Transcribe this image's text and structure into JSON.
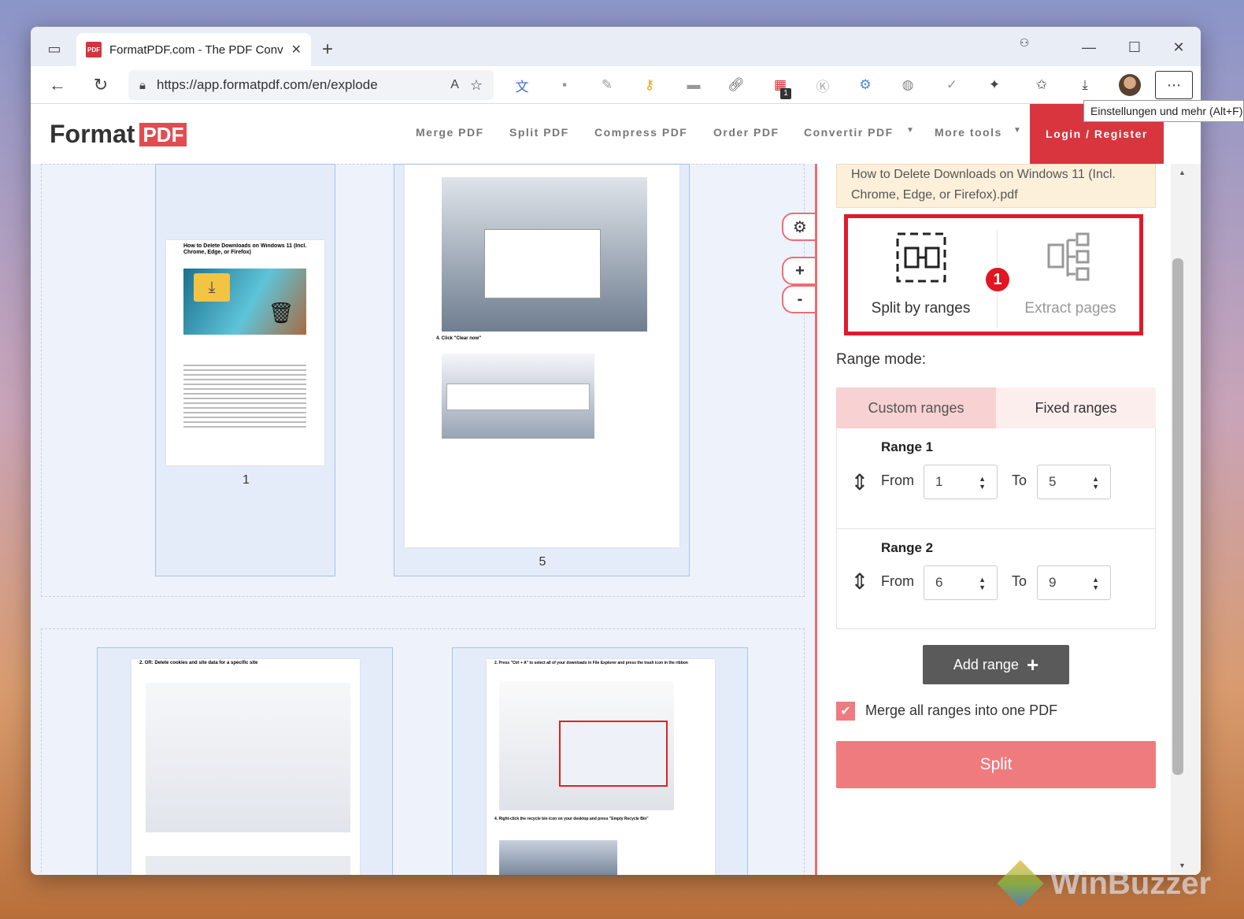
{
  "browser": {
    "tab_title": "FormatPDF.com - The PDF Converter",
    "favicon_text": "PDF",
    "url": "https://app.formatpdf.com/en/explode",
    "tooltip": "Einstellungen und mehr (Alt+F)",
    "extension_badge": "1"
  },
  "site": {
    "logo_text": "Format",
    "logo_badge": "PDF",
    "nav": [
      "Merge PDF",
      "Split PDF",
      "Compress PDF",
      "Order PDF",
      "Convertir PDF",
      "More tools"
    ],
    "login": "Login / Register"
  },
  "pages": {
    "thumb1_label": "1",
    "thumb2_label": "5",
    "thumb1_title": "How to Delete Downloads on Windows 11 (Incl. Chrome, Edge, or Firefox)",
    "thumb2_caption": "4. Click \"Clear now\"",
    "thumb3_heading": "2. OR: Delete cookies and site data for a specific site",
    "thumb4_heading": "2. Press \"Ctrl + A\" to select all of your downloads in File Explorer and press the trash icon in the ribbon",
    "thumb4_caption": "4. Right-click the recycle bin icon on your desktop and press \"Empty Recycle Bin\""
  },
  "controls": {
    "zoom_in": "+",
    "zoom_out": "-"
  },
  "panel": {
    "filename": "How to Delete Downloads on Windows 11 (Incl. Chrome, Edge, or Firefox).pdf",
    "mode_split": "Split by ranges",
    "mode_extract": "Extract pages",
    "badge": "1",
    "range_mode_label": "Range mode:",
    "tab_custom": "Custom ranges",
    "tab_fixed": "Fixed ranges",
    "ranges": [
      {
        "title": "Range 1",
        "from_label": "From",
        "from": "1",
        "to_label": "To",
        "to": "5"
      },
      {
        "title": "Range 2",
        "from_label": "From",
        "from": "6",
        "to_label": "To",
        "to": "9"
      }
    ],
    "add_range": "Add range",
    "merge_label": "Merge all ranges into one PDF",
    "split_button": "Split"
  },
  "watermark": "WinBuzzer",
  "colors": {
    "accent": "#e14c53",
    "highlight": "#e11a2a",
    "split_button": "#ef7b7e"
  }
}
